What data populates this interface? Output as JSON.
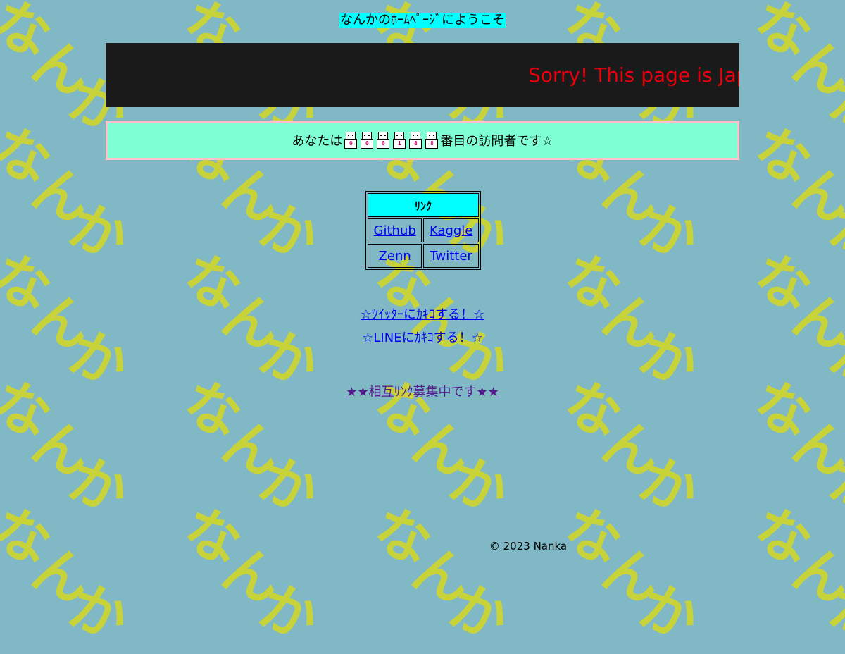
{
  "header": {
    "welcome_text": "なんかのﾎｰﾑﾍﾟｰｼﾞにようこそ"
  },
  "marquee": {
    "text": "Sorry! This page is Japanese only."
  },
  "counter": {
    "prefix": "あなたは",
    "digits": [
      "0",
      "0",
      "0",
      "1",
      "8",
      "8"
    ],
    "suffix": "番目の訪問者です☆"
  },
  "links": {
    "header": "ﾘﾝｸ",
    "items": [
      {
        "label": "Github"
      },
      {
        "label": "Kaggle"
      },
      {
        "label": "Zenn"
      },
      {
        "label": "Twitter"
      }
    ]
  },
  "share": {
    "twitter": "☆ﾂｲｯﾀｰにｶｷｺする！☆",
    "line": "☆LINEにｶｷｺする！☆"
  },
  "mutual_link": "★★相互ﾘﾝｸ募集中です★★",
  "footer": "© 2023 Nanka",
  "background": {
    "pattern_text": [
      "な",
      "ん",
      "か"
    ],
    "color": "#80b8c5",
    "pattern_color": "#c8d33a"
  }
}
